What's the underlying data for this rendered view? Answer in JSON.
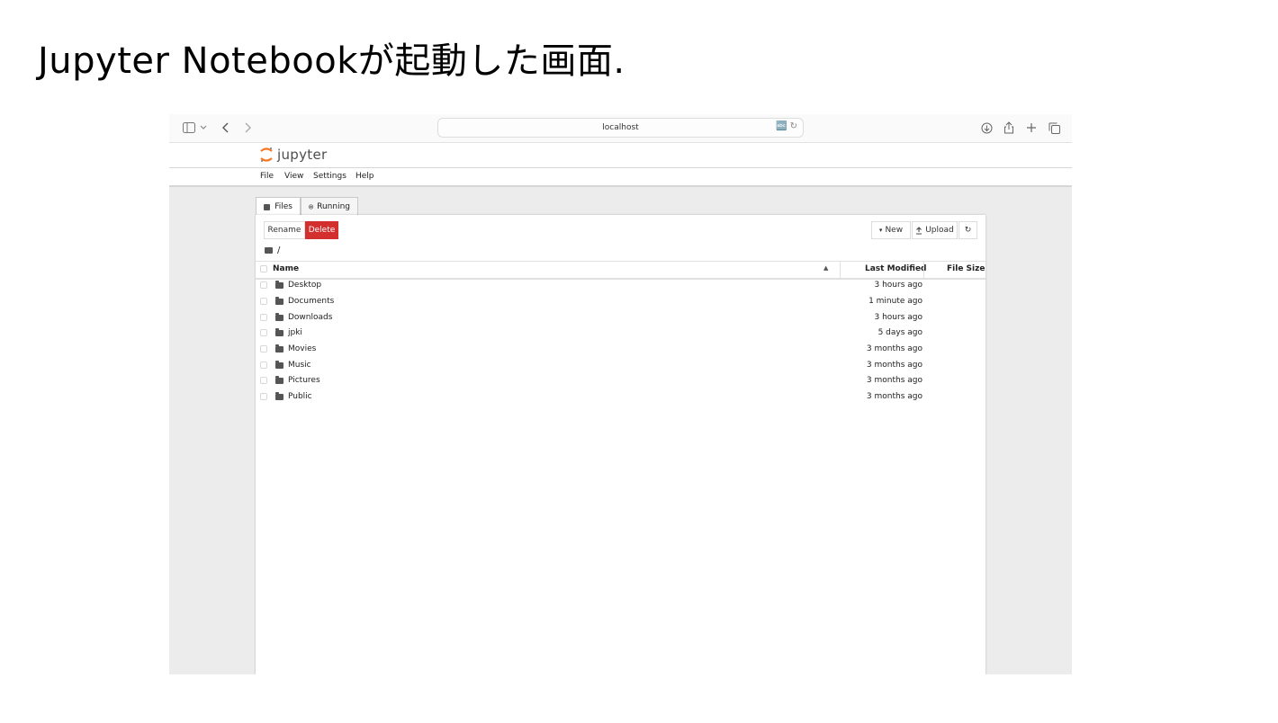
{
  "slide": {
    "title": "Jupyter Notebookが起動した画面."
  },
  "browser": {
    "address": "localhost",
    "icons": [
      "sidebar-icon",
      "chevron-down-icon",
      "back-icon",
      "forward-icon",
      "translate-icon",
      "reload-icon",
      "download-icon",
      "share-icon",
      "plus-icon",
      "tabs-icon"
    ]
  },
  "jupyter": {
    "logo_text": "jupyter",
    "menu": [
      "File",
      "View",
      "Settings",
      "Help"
    ],
    "tabs": [
      {
        "label": "Files"
      },
      {
        "label": "Running"
      }
    ],
    "toolbar": {
      "rename": "Rename",
      "delete": "Delete",
      "new": "New",
      "upload": "Upload"
    },
    "breadcrumb": "/",
    "columns": {
      "name": "Name",
      "last_modified": "Last Modified",
      "file_size": "File Size"
    },
    "rows": [
      {
        "name": "Desktop",
        "modified": "3 hours ago"
      },
      {
        "name": "Documents",
        "modified": "1 minute ago"
      },
      {
        "name": "Downloads",
        "modified": "3 hours ago"
      },
      {
        "name": "jpki",
        "modified": "5 days ago"
      },
      {
        "name": "Movies",
        "modified": "3 months ago"
      },
      {
        "name": "Music",
        "modified": "3 months ago"
      },
      {
        "name": "Pictures",
        "modified": "3 months ago"
      },
      {
        "name": "Public",
        "modified": "3 months ago"
      }
    ],
    "colors": {
      "accent": "#f37726",
      "danger": "#d32f2f"
    }
  }
}
